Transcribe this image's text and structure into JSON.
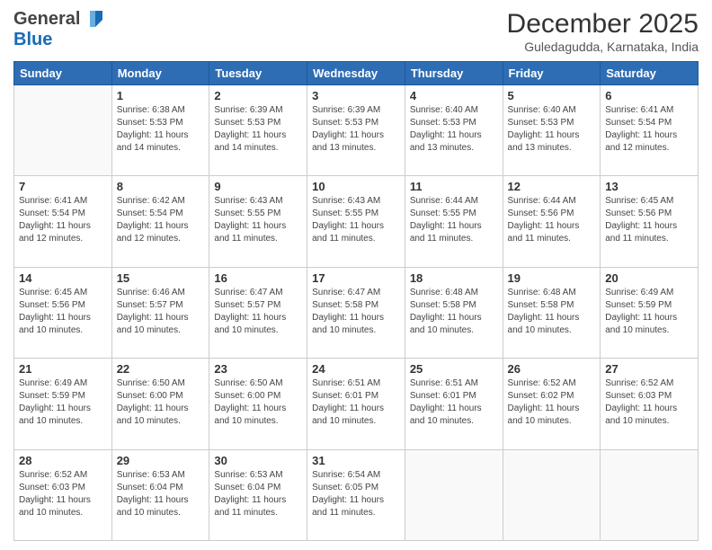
{
  "header": {
    "logo_general": "General",
    "logo_blue": "Blue",
    "month_title": "December 2025",
    "location": "Guledagudda, Karnataka, India"
  },
  "weekdays": [
    "Sunday",
    "Monday",
    "Tuesday",
    "Wednesday",
    "Thursday",
    "Friday",
    "Saturday"
  ],
  "weeks": [
    [
      {
        "date": "",
        "info": ""
      },
      {
        "date": "1",
        "info": "Sunrise: 6:38 AM\nSunset: 5:53 PM\nDaylight: 11 hours\nand 14 minutes."
      },
      {
        "date": "2",
        "info": "Sunrise: 6:39 AM\nSunset: 5:53 PM\nDaylight: 11 hours\nand 14 minutes."
      },
      {
        "date": "3",
        "info": "Sunrise: 6:39 AM\nSunset: 5:53 PM\nDaylight: 11 hours\nand 13 minutes."
      },
      {
        "date": "4",
        "info": "Sunrise: 6:40 AM\nSunset: 5:53 PM\nDaylight: 11 hours\nand 13 minutes."
      },
      {
        "date": "5",
        "info": "Sunrise: 6:40 AM\nSunset: 5:53 PM\nDaylight: 11 hours\nand 13 minutes."
      },
      {
        "date": "6",
        "info": "Sunrise: 6:41 AM\nSunset: 5:54 PM\nDaylight: 11 hours\nand 12 minutes."
      }
    ],
    [
      {
        "date": "7",
        "info": "Sunrise: 6:41 AM\nSunset: 5:54 PM\nDaylight: 11 hours\nand 12 minutes."
      },
      {
        "date": "8",
        "info": "Sunrise: 6:42 AM\nSunset: 5:54 PM\nDaylight: 11 hours\nand 12 minutes."
      },
      {
        "date": "9",
        "info": "Sunrise: 6:43 AM\nSunset: 5:55 PM\nDaylight: 11 hours\nand 11 minutes."
      },
      {
        "date": "10",
        "info": "Sunrise: 6:43 AM\nSunset: 5:55 PM\nDaylight: 11 hours\nand 11 minutes."
      },
      {
        "date": "11",
        "info": "Sunrise: 6:44 AM\nSunset: 5:55 PM\nDaylight: 11 hours\nand 11 minutes."
      },
      {
        "date": "12",
        "info": "Sunrise: 6:44 AM\nSunset: 5:56 PM\nDaylight: 11 hours\nand 11 minutes."
      },
      {
        "date": "13",
        "info": "Sunrise: 6:45 AM\nSunset: 5:56 PM\nDaylight: 11 hours\nand 11 minutes."
      }
    ],
    [
      {
        "date": "14",
        "info": "Sunrise: 6:45 AM\nSunset: 5:56 PM\nDaylight: 11 hours\nand 10 minutes."
      },
      {
        "date": "15",
        "info": "Sunrise: 6:46 AM\nSunset: 5:57 PM\nDaylight: 11 hours\nand 10 minutes."
      },
      {
        "date": "16",
        "info": "Sunrise: 6:47 AM\nSunset: 5:57 PM\nDaylight: 11 hours\nand 10 minutes."
      },
      {
        "date": "17",
        "info": "Sunrise: 6:47 AM\nSunset: 5:58 PM\nDaylight: 11 hours\nand 10 minutes."
      },
      {
        "date": "18",
        "info": "Sunrise: 6:48 AM\nSunset: 5:58 PM\nDaylight: 11 hours\nand 10 minutes."
      },
      {
        "date": "19",
        "info": "Sunrise: 6:48 AM\nSunset: 5:58 PM\nDaylight: 11 hours\nand 10 minutes."
      },
      {
        "date": "20",
        "info": "Sunrise: 6:49 AM\nSunset: 5:59 PM\nDaylight: 11 hours\nand 10 minutes."
      }
    ],
    [
      {
        "date": "21",
        "info": "Sunrise: 6:49 AM\nSunset: 5:59 PM\nDaylight: 11 hours\nand 10 minutes."
      },
      {
        "date": "22",
        "info": "Sunrise: 6:50 AM\nSunset: 6:00 PM\nDaylight: 11 hours\nand 10 minutes."
      },
      {
        "date": "23",
        "info": "Sunrise: 6:50 AM\nSunset: 6:00 PM\nDaylight: 11 hours\nand 10 minutes."
      },
      {
        "date": "24",
        "info": "Sunrise: 6:51 AM\nSunset: 6:01 PM\nDaylight: 11 hours\nand 10 minutes."
      },
      {
        "date": "25",
        "info": "Sunrise: 6:51 AM\nSunset: 6:01 PM\nDaylight: 11 hours\nand 10 minutes."
      },
      {
        "date": "26",
        "info": "Sunrise: 6:52 AM\nSunset: 6:02 PM\nDaylight: 11 hours\nand 10 minutes."
      },
      {
        "date": "27",
        "info": "Sunrise: 6:52 AM\nSunset: 6:03 PM\nDaylight: 11 hours\nand 10 minutes."
      }
    ],
    [
      {
        "date": "28",
        "info": "Sunrise: 6:52 AM\nSunset: 6:03 PM\nDaylight: 11 hours\nand 10 minutes."
      },
      {
        "date": "29",
        "info": "Sunrise: 6:53 AM\nSunset: 6:04 PM\nDaylight: 11 hours\nand 10 minutes."
      },
      {
        "date": "30",
        "info": "Sunrise: 6:53 AM\nSunset: 6:04 PM\nDaylight: 11 hours\nand 11 minutes."
      },
      {
        "date": "31",
        "info": "Sunrise: 6:54 AM\nSunset: 6:05 PM\nDaylight: 11 hours\nand 11 minutes."
      },
      {
        "date": "",
        "info": ""
      },
      {
        "date": "",
        "info": ""
      },
      {
        "date": "",
        "info": ""
      }
    ]
  ]
}
